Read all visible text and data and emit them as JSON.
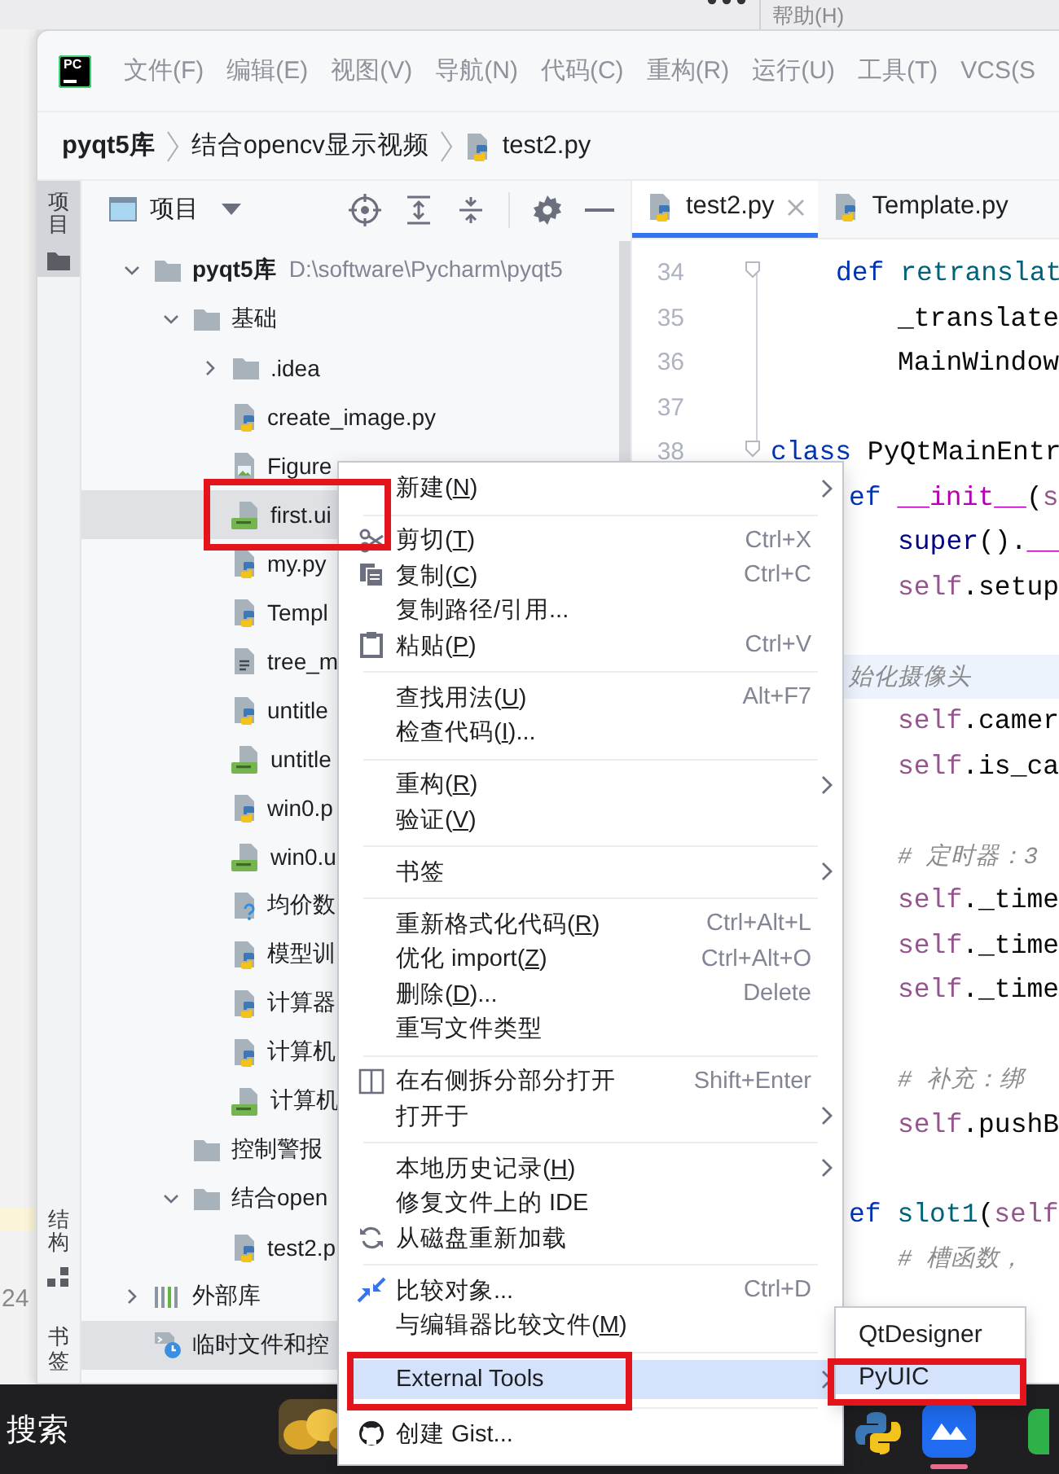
{
  "desktop": {
    "menu_label": "帮助(H)",
    "side_number": "24"
  },
  "title_bar": {
    "logo_text": "PC",
    "menus": [
      "文件(F)",
      "编辑(E)",
      "视图(V)",
      "导航(N)",
      "代码(C)",
      "重构(R)",
      "运行(U)",
      "工具(T)",
      "VCS(S"
    ]
  },
  "breadcrumb": [
    {
      "kind": "project",
      "label": "pyqt5库"
    },
    {
      "kind": "folder",
      "label": "结合opencv显示视频"
    },
    {
      "kind": "file",
      "label": "test2.py"
    }
  ],
  "tool_windows": [
    {
      "label": "项目",
      "selected": true,
      "kind": "top"
    },
    {
      "label": "结构",
      "selected": false,
      "kind": "bottom"
    },
    {
      "label": "书签",
      "selected": false,
      "kind": "bottom"
    }
  ],
  "project": {
    "title": "项目",
    "tree": [
      {
        "kind": "root",
        "label": "pyqt5库",
        "path": "D:\\software\\Pycharm\\pyqt5",
        "expanded": true,
        "selected": false,
        "annotated": false,
        "children": [
          {
            "kind": "folder",
            "label": "基础",
            "expanded": true,
            "selected": false,
            "annotated": false,
            "children": [
              {
                "kind": "folder",
                "label": ".idea",
                "expanded": false,
                "selected": false,
                "annotated": false
              },
              {
                "kind": "py",
                "label": "create_image.py",
                "selected": false,
                "annotated": false
              },
              {
                "kind": "image",
                "label": "Figure",
                "selected": false,
                "annotated": false
              },
              {
                "kind": "qt",
                "label": "first.ui",
                "selected": true,
                "annotated": true
              },
              {
                "kind": "py",
                "label": "my.py",
                "selected": false,
                "annotated": false
              },
              {
                "kind": "py",
                "label": "Templ",
                "selected": false,
                "annotated": false
              },
              {
                "kind": "text",
                "label": "tree_m",
                "selected": false,
                "annotated": false
              },
              {
                "kind": "py",
                "label": "untitle",
                "selected": false,
                "annotated": false
              },
              {
                "kind": "qt",
                "label": "untitle",
                "selected": false,
                "annotated": false
              },
              {
                "kind": "py",
                "label": "win0.p",
                "selected": false,
                "annotated": false
              },
              {
                "kind": "qt",
                "label": "win0.u",
                "selected": false,
                "annotated": false
              },
              {
                "kind": "unknown",
                "label": "均价数",
                "selected": false,
                "annotated": false
              },
              {
                "kind": "py",
                "label": "模型训",
                "selected": false,
                "annotated": false
              },
              {
                "kind": "py",
                "label": "计算器",
                "selected": false,
                "annotated": false
              },
              {
                "kind": "py",
                "label": "计算机",
                "selected": false,
                "annotated": false
              },
              {
                "kind": "qt",
                "label": "计算机",
                "selected": false,
                "annotated": false
              }
            ]
          },
          {
            "kind": "folder",
            "label": "控制警报",
            "selected": false,
            "annotated": false
          },
          {
            "kind": "folder",
            "label": "结合open",
            "expanded": true,
            "selected": false,
            "annotated": false,
            "children": [
              {
                "kind": "py",
                "label": "test2.p",
                "selected": false,
                "annotated": false
              }
            ]
          }
        ]
      },
      {
        "kind": "library",
        "label": "外部库",
        "expanded": false,
        "selected": false,
        "annotated": false
      },
      {
        "kind": "scratch",
        "label": "临时文件和控",
        "selected": true,
        "annotated": false
      }
    ]
  },
  "editor": {
    "tabs": [
      {
        "label": "test2.py",
        "selected": true,
        "closable": true
      },
      {
        "label": "Template.py",
        "selected": false,
        "closable": false
      }
    ],
    "lines": [
      {
        "number": "34",
        "kind": "def",
        "current": false,
        "tokens": [
          {
            "text": "def ",
            "kind": "keyword"
          },
          {
            "text": "retranslat",
            "kind": "function"
          }
        ]
      },
      {
        "number": "35",
        "kind": "body",
        "current": false,
        "tokens": [
          {
            "text": "_translate",
            "kind": "plain"
          }
        ]
      },
      {
        "number": "36",
        "kind": "body",
        "current": false,
        "tokens": [
          {
            "text": "MainWindow",
            "kind": "plain"
          }
        ]
      },
      {
        "number": "37",
        "kind": "blank",
        "current": false
      },
      {
        "number": "38",
        "kind": "class",
        "current": false,
        "tokens": [
          {
            "text": "class ",
            "kind": "keyword"
          },
          {
            "text": "PyQtMainEntr",
            "kind": "plain"
          }
        ]
      },
      {
        "kind": "cut-def",
        "current": false,
        "tokens": [
          {
            "text": "ef ",
            "kind": "keyword"
          },
          {
            "text": "__init__",
            "kind": "magic"
          },
          {
            "text": "(",
            "kind": "plain"
          },
          {
            "text": "s",
            "kind": "self"
          }
        ]
      },
      {
        "kind": "cut-body",
        "current": false,
        "tokens": [
          {
            "text": "super",
            "kind": "builtin"
          },
          {
            "text": "().",
            "kind": "plain"
          },
          {
            "text": "__",
            "kind": "magic"
          }
        ]
      },
      {
        "kind": "cut-body",
        "current": false,
        "tokens": [
          {
            "text": "self",
            "kind": "self"
          },
          {
            "text": ".setup",
            "kind": "plain"
          }
        ]
      },
      {
        "kind": "blank",
        "current": false
      },
      {
        "kind": "cut-def",
        "current": true,
        "tokens": [
          {
            "text": "始化摄像头",
            "kind": "comment"
          }
        ]
      },
      {
        "kind": "cut-body",
        "current": false,
        "tokens": [
          {
            "text": "self",
            "kind": "self"
          },
          {
            "text": ".camer",
            "kind": "plain"
          }
        ]
      },
      {
        "kind": "cut-body",
        "current": false,
        "tokens": [
          {
            "text": "self",
            "kind": "self"
          },
          {
            "text": ".is_ca",
            "kind": "plain"
          }
        ]
      },
      {
        "kind": "blank",
        "current": false
      },
      {
        "kind": "cut-body",
        "current": false,
        "tokens": [
          {
            "text": "# 定时器：3",
            "kind": "comment"
          }
        ]
      },
      {
        "kind": "cut-body",
        "current": false,
        "tokens": [
          {
            "text": "self",
            "kind": "self"
          },
          {
            "text": "._time",
            "kind": "plain"
          }
        ]
      },
      {
        "kind": "cut-body",
        "current": false,
        "tokens": [
          {
            "text": "self",
            "kind": "self"
          },
          {
            "text": "._time",
            "kind": "plain"
          }
        ]
      },
      {
        "kind": "cut-body",
        "current": false,
        "tokens": [
          {
            "text": "self",
            "kind": "self"
          },
          {
            "text": "._time",
            "kind": "plain"
          }
        ]
      },
      {
        "kind": "blank",
        "current": false
      },
      {
        "kind": "cut-body",
        "current": false,
        "tokens": [
          {
            "text": "# 补充：绑",
            "kind": "comment"
          }
        ]
      },
      {
        "kind": "cut-body",
        "current": false,
        "tokens": [
          {
            "text": "self",
            "kind": "self"
          },
          {
            "text": ".pushB",
            "kind": "plain"
          }
        ]
      },
      {
        "kind": "blank",
        "current": false
      },
      {
        "kind": "cut-def",
        "current": false,
        "tokens": [
          {
            "text": "ef ",
            "kind": "keyword"
          },
          {
            "text": "slot1",
            "kind": "function"
          },
          {
            "text": "(",
            "kind": "plain"
          },
          {
            "text": "self",
            "kind": "self"
          }
        ]
      },
      {
        "kind": "cut-body",
        "current": false,
        "tokens": [
          {
            "text": "# 槽函数，",
            "kind": "comment"
          }
        ]
      }
    ]
  },
  "context_menu": {
    "items": [
      {
        "kind": "item",
        "label": [
          "新建(",
          "N",
          ")"
        ],
        "submenu": true,
        "selected": false,
        "annotated": false
      },
      {
        "kind": "separator"
      },
      {
        "kind": "item",
        "label": [
          "剪切(",
          "T",
          ")"
        ],
        "shortcut": "Ctrl+X",
        "submenu": false,
        "selected": false,
        "annotated": false
      },
      {
        "kind": "item",
        "label": [
          "复制(",
          "C",
          ")"
        ],
        "shortcut": "Ctrl+C",
        "submenu": false,
        "selected": false,
        "annotated": false
      },
      {
        "kind": "item",
        "label": [
          "复制路径/引用..."
        ],
        "submenu": false,
        "selected": false,
        "annotated": false
      },
      {
        "kind": "item",
        "label": [
          "粘贴(",
          "P",
          ")"
        ],
        "shortcut": "Ctrl+V",
        "submenu": false,
        "selected": false,
        "annotated": false
      },
      {
        "kind": "separator"
      },
      {
        "kind": "item",
        "label": [
          "查找用法(",
          "U",
          ")"
        ],
        "shortcut": "Alt+F7",
        "submenu": false,
        "selected": false,
        "annotated": false
      },
      {
        "kind": "item",
        "label": [
          "检查代码(",
          "I",
          ")..."
        ],
        "submenu": false,
        "selected": false,
        "annotated": false
      },
      {
        "kind": "separator"
      },
      {
        "kind": "item",
        "label": [
          "重构(",
          "R",
          ")"
        ],
        "submenu": true,
        "selected": false,
        "annotated": false
      },
      {
        "kind": "item",
        "label": [
          "验证(",
          "V",
          ")"
        ],
        "submenu": false,
        "selected": false,
        "annotated": false
      },
      {
        "kind": "separator"
      },
      {
        "kind": "item",
        "label": [
          "书签"
        ],
        "submenu": true,
        "selected": false,
        "annotated": false
      },
      {
        "kind": "separator"
      },
      {
        "kind": "item",
        "label": [
          "重新格式化代码(",
          "R",
          ")"
        ],
        "shortcut": "Ctrl+Alt+L",
        "submenu": false,
        "selected": false,
        "annotated": false
      },
      {
        "kind": "item",
        "label": [
          "优化 import(",
          "Z",
          ")"
        ],
        "shortcut": "Ctrl+Alt+O",
        "submenu": false,
        "selected": false,
        "annotated": false
      },
      {
        "kind": "item",
        "label": [
          "删除(",
          "D",
          ")..."
        ],
        "shortcut": "Delete",
        "submenu": false,
        "selected": false,
        "annotated": false
      },
      {
        "kind": "item",
        "label": [
          "重写文件类型"
        ],
        "submenu": false,
        "selected": false,
        "annotated": false
      },
      {
        "kind": "separator"
      },
      {
        "kind": "item",
        "label": [
          "在右侧拆分部分打开"
        ],
        "shortcut": "Shift+Enter",
        "submenu": false,
        "selected": false,
        "annotated": false
      },
      {
        "kind": "item",
        "label": [
          "打开于"
        ],
        "submenu": true,
        "selected": false,
        "annotated": false
      },
      {
        "kind": "separator"
      },
      {
        "kind": "item",
        "label": [
          "本地历史记录(",
          "H",
          ")"
        ],
        "submenu": true,
        "selected": false,
        "annotated": false
      },
      {
        "kind": "item",
        "label": [
          "修复文件上的 IDE"
        ],
        "submenu": false,
        "selected": false,
        "annotated": false
      },
      {
        "kind": "item",
        "label": [
          "从磁盘重新加载"
        ],
        "submenu": false,
        "selected": false,
        "annotated": false
      },
      {
        "kind": "separator"
      },
      {
        "kind": "item",
        "label": [
          "比较对象..."
        ],
        "shortcut": "Ctrl+D",
        "submenu": false,
        "selected": false,
        "annotated": false
      },
      {
        "kind": "item",
        "label": [
          "与编辑器比较文件(",
          "M",
          ")"
        ],
        "submenu": false,
        "selected": false,
        "annotated": false
      },
      {
        "kind": "separator"
      },
      {
        "kind": "item",
        "label": [
          "External Tools"
        ],
        "submenu": true,
        "selected": true,
        "annotated": true
      },
      {
        "kind": "separator"
      },
      {
        "kind": "item",
        "label": [
          "创建 Gist..."
        ],
        "submenu": false,
        "selected": false,
        "annotated": false
      }
    ]
  },
  "submenu": {
    "items": [
      {
        "label": "QtDesigner",
        "selected": false,
        "annotated": false
      },
      {
        "label": "PyUIC",
        "selected": true,
        "annotated": true
      }
    ]
  },
  "taskbar": {
    "search_label": "搜索",
    "apps": [
      {
        "kind": "coins",
        "active": false
      },
      {
        "kind": "python",
        "active": false
      },
      {
        "kind": "cloud",
        "active": true
      },
      {
        "kind": "green",
        "active": false
      }
    ]
  }
}
